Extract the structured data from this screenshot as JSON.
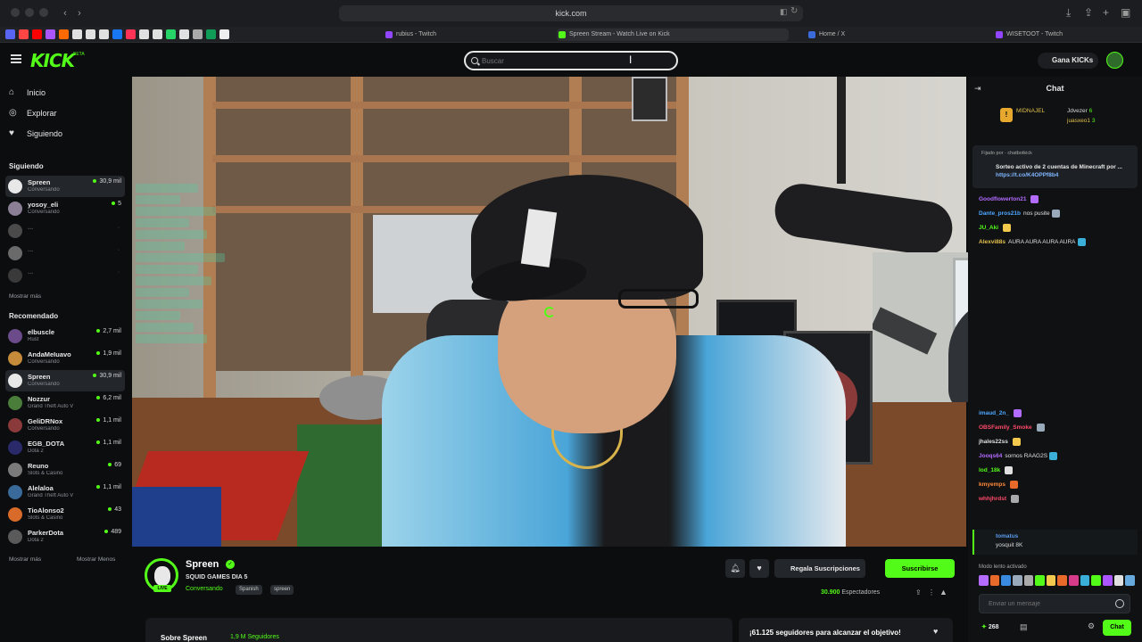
{
  "browser": {
    "url": "kick.com",
    "tabs": [
      {
        "label": "rubius - Twitch",
        "color": "#9146ff"
      },
      {
        "label": "Spreen Stream - Watch Live on Kick",
        "color": "#53fc18"
      },
      {
        "label": "Home / X",
        "color": "#3a6bd8"
      },
      {
        "label": "WISETOOT - Twitch",
        "color": "#9146ff"
      }
    ],
    "bookmark_colors": [
      "#5865f2",
      "#ff4444",
      "#ff0000",
      "#aa55ff",
      "#ff6a00",
      "#e0e0e0",
      "#e0e0e0",
      "#e0e0e0",
      "#1877f2",
      "#ff3355",
      "#e0e0e0",
      "#e0e0e0",
      "#25d366",
      "#e0e0e0",
      "#aaaaaa",
      "#0f9d58",
      "#eeeeee"
    ]
  },
  "header": {
    "logo": "KICK",
    "logo_sup": "BETA",
    "search_placeholder": "Buscar",
    "kick_button": "Gana KICKs",
    "colors": {
      "brand": "#53fc18"
    }
  },
  "sidebar": {
    "nav": [
      {
        "label": "Inicio",
        "icon": "home-icon"
      },
      {
        "label": "Explorar",
        "icon": "compass-icon"
      },
      {
        "label": "Siguiendo",
        "icon": "heart-icon"
      }
    ],
    "following_title": "Siguiendo",
    "following": [
      {
        "name": "Spreen",
        "category": "Conversando",
        "viewers": "30,9 mil",
        "live": true,
        "color": "#e8e8e8",
        "active": true
      },
      {
        "name": "yosoy_eli",
        "category": "Conversando",
        "viewers": "5",
        "live": true,
        "color": "#8a7f94"
      },
      {
        "name": "...",
        "category": "",
        "viewers": "",
        "live": false,
        "color": "#4a4a4a"
      },
      {
        "name": "...",
        "category": "",
        "viewers": "",
        "live": false,
        "color": "#6a6a6a"
      },
      {
        "name": "...",
        "category": "",
        "viewers": "",
        "live": false,
        "color": "#3a3a3a"
      }
    ],
    "show_more_1": "Mostrar más",
    "recommended_title": "Recomendado",
    "recommended": [
      {
        "name": "elbuscle",
        "category": "Rust",
        "viewers": "2,7 mil",
        "color": "#6b4b8a"
      },
      {
        "name": "AndaMeIuavo",
        "category": "Conversando",
        "viewers": "1,9 mil",
        "color": "#c58a3a"
      },
      {
        "name": "Spreen",
        "category": "Conversando",
        "viewers": "30,9 mil",
        "color": "#e8e8e8",
        "active": true
      },
      {
        "name": "Nozzur",
        "category": "Grand Theft Auto V",
        "viewers": "6,2 mil",
        "color": "#4a7c3a"
      },
      {
        "name": "GeliDRNox",
        "category": "Conversando",
        "viewers": "1,1 mil",
        "color": "#8a3a3a"
      },
      {
        "name": "EGB_DOTA",
        "category": "Dota 2",
        "viewers": "1,1 mil",
        "color": "#2a2a6a"
      },
      {
        "name": "Reuno",
        "category": "Slots & Casino",
        "viewers": "69",
        "color": "#7a7a7a"
      },
      {
        "name": "Alelaloa",
        "category": "Grand Theft Auto V",
        "viewers": "1,1 mil",
        "color": "#3a6a9a"
      },
      {
        "name": "TioAlonso2",
        "category": "Slots & Casino",
        "viewers": "43",
        "color": "#d86a2a"
      },
      {
        "name": "ParkerDota",
        "category": "Dota 2",
        "viewers": "489",
        "color": "#5a5a5a"
      }
    ],
    "show_more_2": "Mostrar más",
    "show_less": "Mostrar Menos"
  },
  "stream": {
    "name": "Spreen",
    "title": "SQUID GAMES DIA 5",
    "category": "Conversando",
    "tags": [
      "Spanish",
      "spreen"
    ],
    "live_label": "LIVE",
    "gift_button": "Regala Suscripciones",
    "subscribe_button": "Suscribirse",
    "viewers": "30.900",
    "viewers_label": "Espectadores",
    "about_title": "Sobre Spreen",
    "about_followers": "1,9 M Seguidores",
    "goal_text": "¡61.125 seguidores para alcanzar el objetivo!"
  },
  "chat": {
    "title": "Chat",
    "leaderboard": [
      {
        "name": "MIDNAJEL",
        "value": "",
        "color": "#e3c04c"
      },
      {
        "name": "Jdvezer",
        "value": "6",
        "color": "#d8d8d8"
      },
      {
        "name": "juasxeo1",
        "value": "3",
        "color": "#e3c04c"
      }
    ],
    "pinned_by": "Fijado por  ·  chatbotkick",
    "pinned_text": "Sorteo activo de 2 cuentas de Minecraft por ...",
    "pinned_link": "https://t.co/K4OPPf8b4",
    "messages_top": [
      {
        "user": "Goodflowerton21",
        "text": "",
        "color": "#b46bff"
      },
      {
        "user": "Dante_pros21b",
        "text": "nos pusite",
        "color": "#4fa7ff"
      },
      {
        "user": "JU_Aki",
        "text": "",
        "color": "#53fc18"
      },
      {
        "user": "Alexvi88s",
        "text": "AURA AURA AURA AURA",
        "color": "#e3c04c"
      }
    ],
    "messages_bottom": [
      {
        "user": "imaud_2n_",
        "text": "",
        "color": "#4fa7ff"
      },
      {
        "user": "OBSFamily_Smoke",
        "text": "",
        "color": "#ff4a6a"
      },
      {
        "user": "jhales22ss",
        "text": "",
        "color": "#e0e0e0"
      },
      {
        "user": "Jooqs64",
        "text": "sornos RAAG2S",
        "color": "#b46bff"
      },
      {
        "user": "lod_18k",
        "text": "",
        "color": "#53fc18"
      },
      {
        "user": "kmyemps",
        "text": "",
        "color": "#ff8a3a"
      },
      {
        "user": "whhjhrdst",
        "text": "",
        "color": "#ff4a6a"
      }
    ],
    "reply_user": "tomatus",
    "reply_text": "yosquit 8K",
    "slow_mode": "Modo lento activado",
    "input_placeholder": "Enviar un mensaje",
    "points": "268",
    "send_button": "Chat",
    "emote_colors": [
      "#b46bff",
      "#e86a2a",
      "#3a8adf",
      "#9ab",
      "#aaa",
      "#53fc18",
      "#f2c94c",
      "#e86a2a",
      "#d63b8a",
      "#3aafd8",
      "#53fc18",
      "#aa55ff",
      "#e0e0e0",
      "#6ad"
    ]
  }
}
